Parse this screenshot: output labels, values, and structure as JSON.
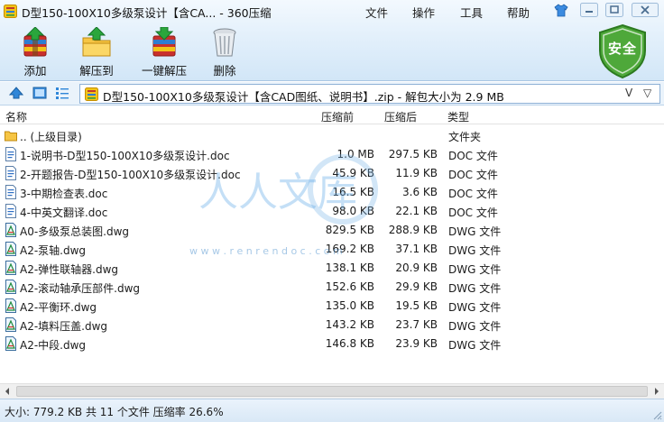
{
  "window": {
    "title": "D型150-100X10多级泵设计【含CA... - 360压缩",
    "menu": [
      "文件",
      "操作",
      "工具",
      "帮助"
    ]
  },
  "toolbar": {
    "add": "添加",
    "extract_to": "解压到",
    "one_click_extract": "一键解压",
    "delete": "删除"
  },
  "security_badge": "安全",
  "address": {
    "path": "D型150-100X10多级泵设计【含CAD图纸、说明书】.zip - 解包大小为 2.9 MB",
    "dropdown": "V",
    "up": "▽"
  },
  "columns": {
    "name": "名称",
    "packed_before": "压缩前",
    "packed_after": "压缩后",
    "type": "类型"
  },
  "files": [
    {
      "icon": "folder-icon",
      "name": ".. (上级目录)",
      "before": "",
      "after": "",
      "type": "文件夹"
    },
    {
      "icon": "doc-file-icon",
      "name": "1-说明书-D型150-100X10多级泵设计.doc",
      "before": "1.0 MB",
      "after": "297.5 KB",
      "type": "DOC 文件"
    },
    {
      "icon": "doc-file-icon",
      "name": "2-开题报告-D型150-100X10多级泵设计.doc",
      "before": "45.9 KB",
      "after": "11.9 KB",
      "type": "DOC 文件"
    },
    {
      "icon": "doc-file-icon",
      "name": "3-中期检查表.doc",
      "before": "16.5 KB",
      "after": "3.6 KB",
      "type": "DOC 文件"
    },
    {
      "icon": "doc-file-icon",
      "name": "4-中英文翻译.doc",
      "before": "98.0 KB",
      "after": "22.1 KB",
      "type": "DOC 文件"
    },
    {
      "icon": "dwg-file-icon",
      "name": "A0-多级泵总装图.dwg",
      "before": "829.5 KB",
      "after": "288.9 KB",
      "type": "DWG 文件"
    },
    {
      "icon": "dwg-file-icon",
      "name": "A2-泵轴.dwg",
      "before": "169.2 KB",
      "after": "37.1 KB",
      "type": "DWG 文件"
    },
    {
      "icon": "dwg-file-icon",
      "name": "A2-弹性联轴器.dwg",
      "before": "138.1 KB",
      "after": "20.9 KB",
      "type": "DWG 文件"
    },
    {
      "icon": "dwg-file-icon",
      "name": "A2-滚动轴承压部件.dwg",
      "before": "152.6 KB",
      "after": "29.9 KB",
      "type": "DWG 文件"
    },
    {
      "icon": "dwg-file-icon",
      "name": "A2-平衡环.dwg",
      "before": "135.0 KB",
      "after": "19.5 KB",
      "type": "DWG 文件"
    },
    {
      "icon": "dwg-file-icon",
      "name": "A2-填料压盖.dwg",
      "before": "143.2 KB",
      "after": "23.7 KB",
      "type": "DWG 文件"
    },
    {
      "icon": "dwg-file-icon",
      "name": "A2-中段.dwg",
      "before": "146.8 KB",
      "after": "23.9 KB",
      "type": "DWG 文件"
    }
  ],
  "watermark": {
    "glyphs": "人人文库",
    "url": "w w w . r e n r e n d o c . c o m"
  },
  "status": "大小: 779.2 KB 共 11 个文件 压缩率 26.6%",
  "colors": {
    "accent": "#1a6fc4",
    "shield": "#4ea83a",
    "header_top": "#f3f9fe",
    "header_bottom": "#d2e6f7"
  }
}
